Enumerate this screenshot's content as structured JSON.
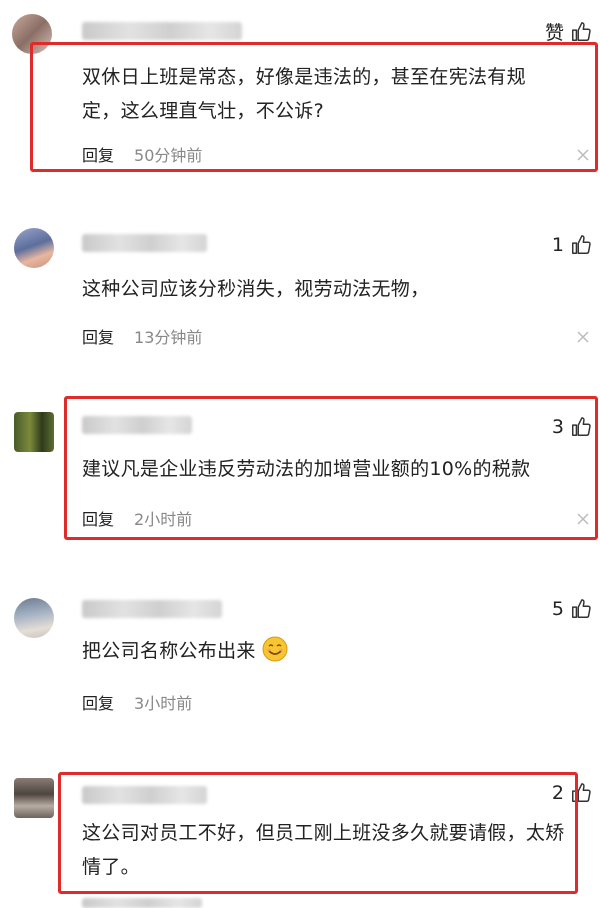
{
  "comments": [
    {
      "like_count": "",
      "like_label": "赞",
      "text": "双休日上班是常态，好像是违法的，甚至在宪法有规定，这么理直气壮，不公诉?",
      "reply": "回复",
      "time": "50分钟前"
    },
    {
      "like_count": "1",
      "like_label": "",
      "text": "这种公司应该分秒消失，视劳动法无物，",
      "reply": "回复",
      "time": "13分钟前"
    },
    {
      "like_count": "3",
      "like_label": "",
      "text": "建议凡是企业违反劳动法的加增营业额的10%的税款",
      "reply": "回复",
      "time": "2小时前"
    },
    {
      "like_count": "5",
      "like_label": "",
      "text": "把公司名称公布出来",
      "reply": "回复",
      "time": "3小时前"
    },
    {
      "like_count": "2",
      "like_label": "",
      "text": "这公司对员工不好，但员工刚上班没多久就要请假，太矫情了。",
      "reply": "",
      "time": ""
    }
  ],
  "colors": {
    "highlight": "#e02b2b",
    "time": "#888888",
    "text": "#222222"
  },
  "icons": {
    "like": "thumbs-up-icon",
    "close": "close-icon",
    "emoji": "smile-emoji-icon"
  }
}
